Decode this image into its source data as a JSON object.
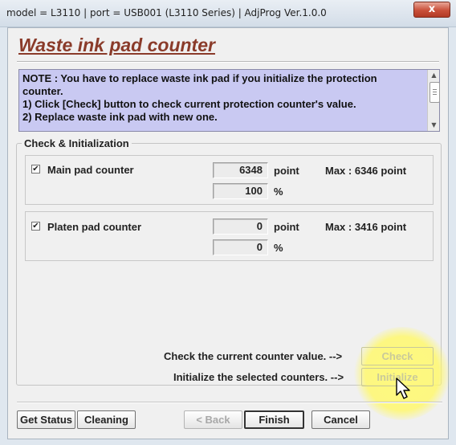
{
  "window": {
    "title": "model = L3110 | port = USB001 (L3110 Series) | AdjProg Ver.1.0.0",
    "close_glyph": "x"
  },
  "page": {
    "heading": "Waste ink pad counter",
    "note_lines": [
      "NOTE : You have to replace waste ink pad if you initialize the protection",
      "counter.",
      "1) Click [Check] button to check current protection counter's value.",
      "2) Replace waste ink pad with new one."
    ]
  },
  "group": {
    "label": "Check & Initialization",
    "counters": [
      {
        "name": "Main pad counter",
        "checked": true,
        "value": "6348",
        "unit": "point",
        "max_text": "Max : 6346 point",
        "percent": "100",
        "percent_unit": "%"
      },
      {
        "name": "Platen pad counter",
        "checked": true,
        "value": "0",
        "unit": "point",
        "max_text": "Max : 3416 point",
        "percent": "0",
        "percent_unit": "%"
      }
    ],
    "check_prompt": "Check the current counter value. -->",
    "check_button": "Check",
    "init_prompt": "Initialize the selected counters. -->",
    "init_button": "Initialize"
  },
  "footer": {
    "get_status": "Get Status",
    "cleaning": "Cleaning",
    "back": "< Back",
    "finish": "Finish",
    "cancel": "Cancel"
  },
  "icons": {
    "checkbox_mark": "✔",
    "scroll_up": "▲",
    "scroll_down": "▼",
    "cursor": "mouse-pointer-icon"
  },
  "colors": {
    "heading": "#8a3b2a",
    "note_background": "#c9c9f2",
    "highlight": "#fff46e"
  }
}
